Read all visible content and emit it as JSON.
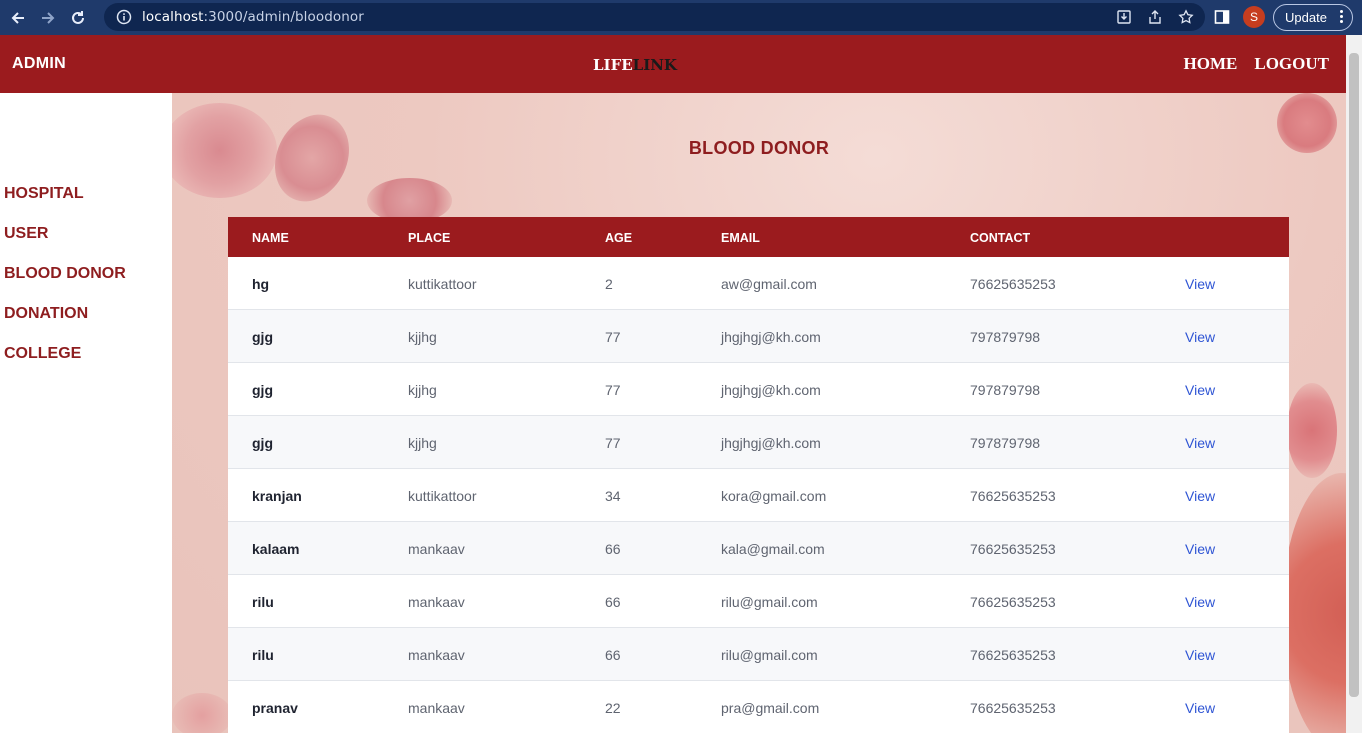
{
  "browser": {
    "url_host": "localhost",
    "url_rest": ":3000/admin/bloodonor",
    "avatar_letter": "S",
    "update_label": "Update"
  },
  "header": {
    "admin_label": "ADMIN",
    "logo_part1": "LIFE",
    "logo_part2": "LINK",
    "nav": {
      "home": "HOME",
      "logout": "LOGOUT"
    }
  },
  "sidebar": {
    "items": [
      "HOSPITAL",
      "USER",
      "BLOOD DONOR",
      "DONATION",
      "COLLEGE"
    ]
  },
  "page": {
    "title": "BLOOD DONOR"
  },
  "table": {
    "headers": [
      "NAME",
      "PLACE",
      "AGE",
      "EMAIL",
      "CONTACT"
    ],
    "rows": [
      {
        "name": "hg",
        "place": "kuttikattoor",
        "age": "2",
        "email": "aw@gmail.com",
        "contact": "76625635253",
        "action": "View"
      },
      {
        "name": "gjg",
        "place": "kjjhg",
        "age": "77",
        "email": "jhgjhgj@kh.com",
        "contact": "797879798",
        "action": "View"
      },
      {
        "name": "gjg",
        "place": "kjjhg",
        "age": "77",
        "email": "jhgjhgj@kh.com",
        "contact": "797879798",
        "action": "View"
      },
      {
        "name": "gjg",
        "place": "kjjhg",
        "age": "77",
        "email": "jhgjhgj@kh.com",
        "contact": "797879798",
        "action": "View"
      },
      {
        "name": "kranjan",
        "place": "kuttikattoor",
        "age": "34",
        "email": "kora@gmail.com",
        "contact": "76625635253",
        "action": "View"
      },
      {
        "name": "kalaam",
        "place": "mankaav",
        "age": "66",
        "email": "kala@gmail.com",
        "contact": "76625635253",
        "action": "View"
      },
      {
        "name": "rilu",
        "place": "mankaav",
        "age": "66",
        "email": "rilu@gmail.com",
        "contact": "76625635253",
        "action": "View"
      },
      {
        "name": "rilu",
        "place": "mankaav",
        "age": "66",
        "email": "rilu@gmail.com",
        "contact": "76625635253",
        "action": "View"
      },
      {
        "name": "pranav",
        "place": "mankaav",
        "age": "22",
        "email": "pra@gmail.com",
        "contact": "76625635253",
        "action": "View"
      }
    ]
  },
  "colors": {
    "brand_red": "#9b1b1e",
    "sidebar_text": "#8e1d1f",
    "link_blue": "#2f55d4"
  }
}
